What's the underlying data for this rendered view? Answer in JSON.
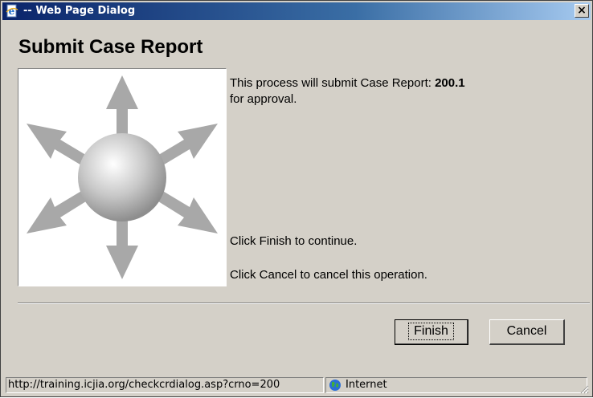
{
  "window": {
    "title": "-- Web Page Dialog",
    "close_glyph": "×",
    "icon": "ie-page-icon"
  },
  "dialog": {
    "heading": "Submit Case Report",
    "image_icon": "arrows-burst-sphere-icon",
    "message_prefix": "This process will submit Case Report: ",
    "case_number": "200.1",
    "message_suffix": "for approval.",
    "instruction_finish": "Click Finish to continue.",
    "instruction_cancel": "Click Cancel to cancel this operation."
  },
  "buttons": {
    "finish_label": "Finish",
    "cancel_label": "Cancel"
  },
  "statusbar": {
    "url": "http://training.icjia.org/checkcrdialog.asp?crno=200",
    "zone_label": "Internet",
    "zone_icon": "globe-icon"
  },
  "colors": {
    "titlebar_start": "#0a246a",
    "titlebar_end": "#a6caf0",
    "window_face": "#d4d0c8"
  }
}
